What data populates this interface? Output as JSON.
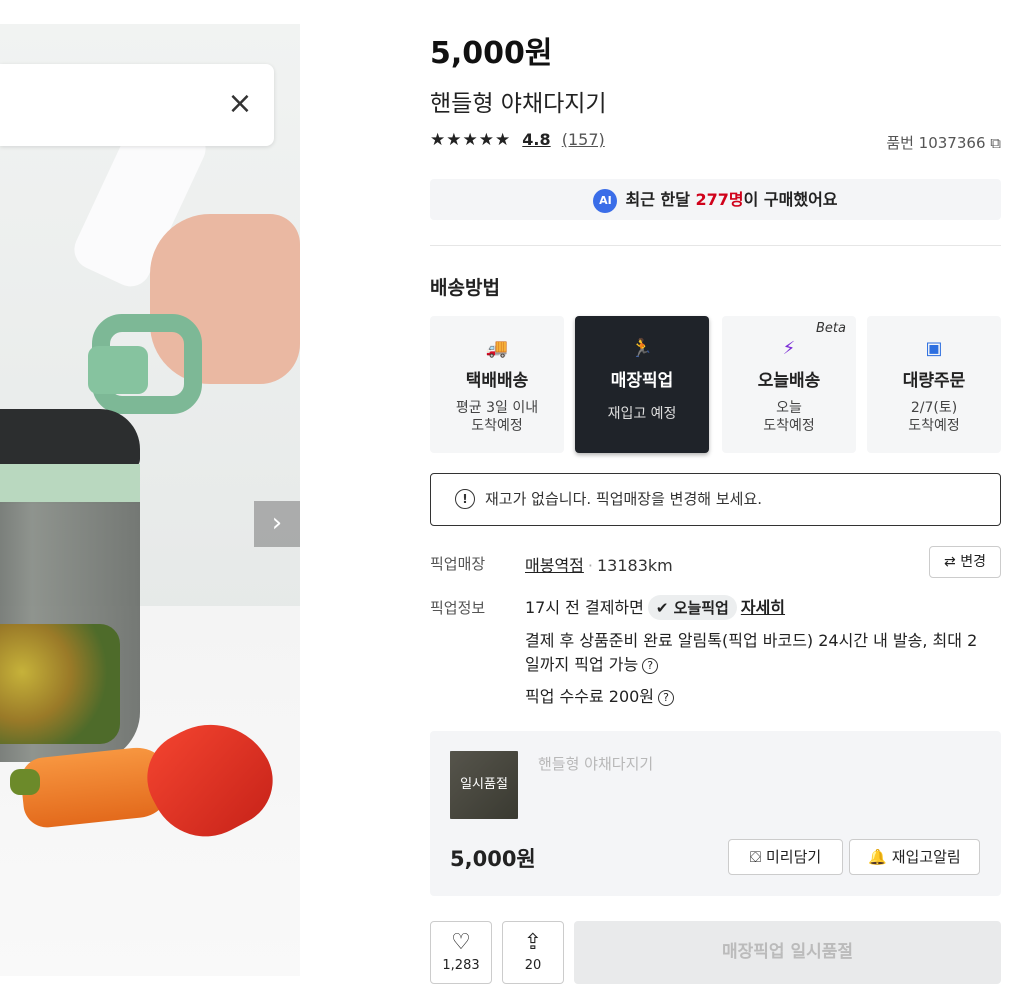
{
  "gallery": {
    "close_icon": "close-icon",
    "next_icon": "chevron-right-icon",
    "close_glyph": "×",
    "next_glyph": "›"
  },
  "product": {
    "price": "5,000원",
    "title": "핸들형 야채다지기",
    "stars": "★★★★★",
    "rating": "4.8",
    "reviews": "(157)",
    "sku": "품번 1037366"
  },
  "ai_notice": {
    "badge": "AI",
    "prefix": "최근 한달 ",
    "count": "277명",
    "suffix": "이 구매했어요"
  },
  "delivery": {
    "section_title": "배송방법",
    "options": [
      {
        "name": "택배배송",
        "desc_line1": "평균 3일 이내",
        "desc_line2": "도착예정",
        "icon": "truck-icon",
        "selected": false
      },
      {
        "name": "매장픽업",
        "desc_line1": "재입고 예정",
        "desc_line2": "",
        "icon": "runner-icon",
        "selected": true
      },
      {
        "name": "오늘배송",
        "desc_line1": "오늘",
        "desc_line2": "도착예정",
        "icon": "today-delivery-icon",
        "selected": false,
        "tag": "Beta"
      },
      {
        "name": "대량주문",
        "desc_line1": "2/7(토)",
        "desc_line2": "도착예정",
        "icon": "box-icon",
        "selected": false
      }
    ]
  },
  "warning": {
    "text": "재고가 없습니다. 픽업매장을 변경해 보세요.",
    "icon": "!"
  },
  "pickup": {
    "store_label": "픽업매장",
    "store_name": "매봉역점",
    "distance": "13183km",
    "change_label": "⇄ 변경",
    "info_label": "픽업정보",
    "line1_prefix": "17시 전 결제하면",
    "today_pickup": "오늘픽업",
    "detail_link": "자세히",
    "line2": "결제 후 상품준비 완료 알림톡(픽업 바코드) 24시간 내 발송, 최대 2",
    "line3": "일까지 픽업 가능",
    "line4": "픽업 수수료 200원"
  },
  "cart": {
    "soldout_badge": "일시품절",
    "name": "핸들형 야채다지기",
    "price": "5,000원",
    "preorder_label": "미리담기",
    "restock_label": "재입고알림"
  },
  "actions": {
    "like_count": "1,283",
    "share_count": "20",
    "buy_label": "매장픽업 일시품절"
  }
}
